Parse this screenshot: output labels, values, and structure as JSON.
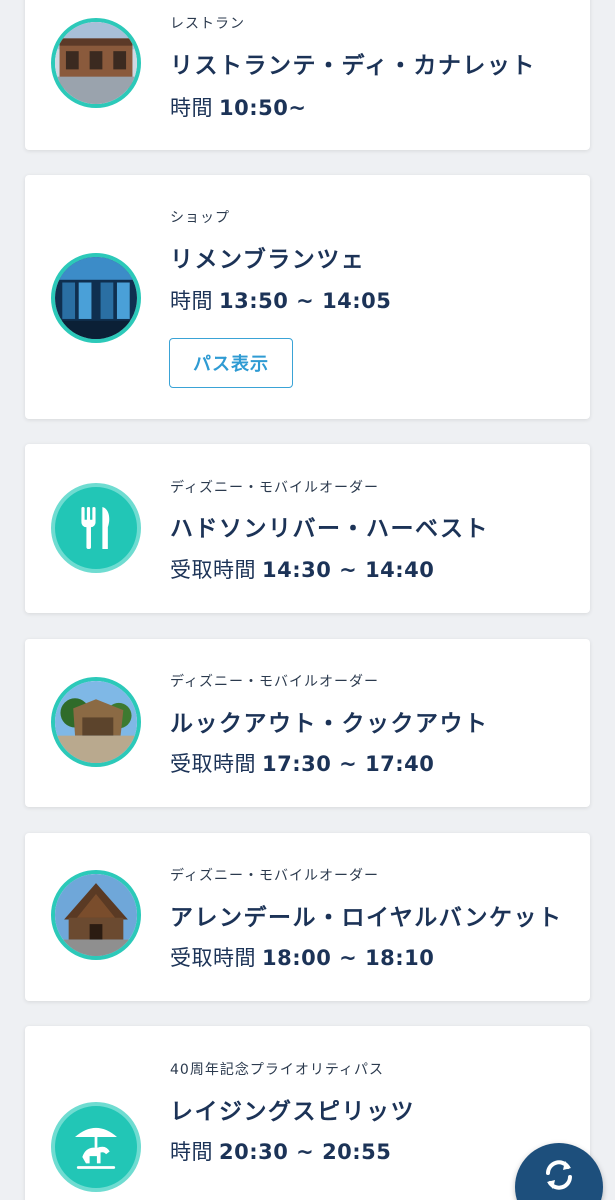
{
  "items": [
    {
      "category": "レストラン",
      "name": "リストランテ・ディ・カナレット",
      "time_label": "時間",
      "time_value": "10:50~",
      "thumb": "restaurant-photo"
    },
    {
      "category": "ショップ",
      "name": "リメンブランツェ",
      "time_label": "時間",
      "time_value": "13:50 ~ 14:05",
      "button": "パス表示",
      "thumb": "shop-photo"
    },
    {
      "category": "ディズニー・モバイルオーダー",
      "name": "ハドソンリバー・ハーベスト",
      "time_label": "受取時間",
      "time_value": "14:30 ~ 14:40",
      "thumb": "fork-knife-icon"
    },
    {
      "category": "ディズニー・モバイルオーダー",
      "name": "ルックアウト・クックアウト",
      "time_label": "受取時間",
      "time_value": "17:30 ~ 17:40",
      "thumb": "lookout-photo"
    },
    {
      "category": "ディズニー・モバイルオーダー",
      "name": "アレンデール・ロイヤルバンケット",
      "time_label": "受取時間",
      "time_value": "18:00 ~ 18:10",
      "thumb": "arendelle-photo"
    },
    {
      "category": "40周年記念プライオリティパス",
      "name": "レイジングスピリッツ",
      "time_label": "時間",
      "time_value": "20:30 ~ 20:55",
      "thumb": "attraction-icon"
    }
  ],
  "fab": {
    "icon": "refresh-icon"
  },
  "colors": {
    "accent": "#2cc9b9",
    "navy": "#1c3357",
    "link": "#2f9bd3",
    "fab": "#1d4f7c"
  }
}
